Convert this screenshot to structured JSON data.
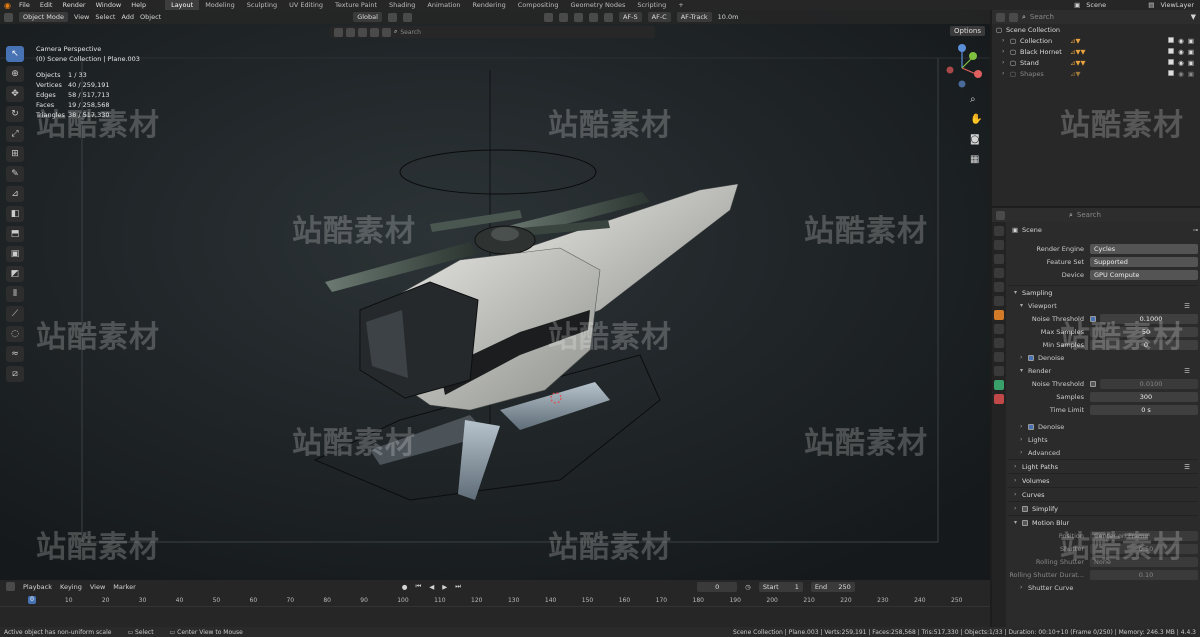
{
  "menus": [
    "File",
    "Edit",
    "Render",
    "Window",
    "Help"
  ],
  "workspaces": [
    "Layout",
    "Modeling",
    "Sculpting",
    "UV Editing",
    "Texture Paint",
    "Shading",
    "Animation",
    "Rendering",
    "Compositing",
    "Geometry Nodes",
    "Scripting"
  ],
  "scene_name": "Scene",
  "view_layer": "ViewLayer",
  "viewport": {
    "mode": "Object Mode",
    "menus": [
      "View",
      "Select",
      "Add",
      "Object"
    ],
    "transform": "Global",
    "af_labels": [
      "AF-S",
      "AF-C",
      "AF-Track"
    ],
    "distance": "10.0m",
    "options_label": "Options",
    "search_placeholder": "Search"
  },
  "stats": {
    "camera": "Camera Perspective",
    "path": "(0) Scene Collection | Plane.003",
    "rows": [
      {
        "k": "Objects",
        "v": "1 / 33"
      },
      {
        "k": "Vertices",
        "v": "40 / 259,191"
      },
      {
        "k": "Edges",
        "v": "58 / 517,713"
      },
      {
        "k": "Faces",
        "v": "19 / 258,568"
      },
      {
        "k": "Triangles",
        "v": "38 / 517,330"
      }
    ]
  },
  "watermark": "站酷素材",
  "outliner": {
    "search_placeholder": "Search",
    "root": "Scene Collection",
    "items": [
      "Collection",
      "Black Hornet",
      "Stand",
      "Shapes"
    ]
  },
  "properties": {
    "search_placeholder": "Search",
    "context": "Scene",
    "render_engine_label": "Render Engine",
    "render_engine": "Cycles",
    "feature_set_label": "Feature Set",
    "feature_set": "Supported",
    "device_label": "Device",
    "device": "GPU Compute",
    "sampling": "Sampling",
    "viewport": "Viewport",
    "noise_threshold_label": "Noise Threshold",
    "vp_noise": "0.1000",
    "max_samples_label": "Max Samples",
    "vp_max": "50",
    "min_samples_label": "Min Samples",
    "vp_min": "0",
    "denoise": "Denoise",
    "render": "Render",
    "r_noise": "0.0100",
    "samples_label": "Samples",
    "r_samples": "300",
    "time_limit_label": "Time Limit",
    "r_time": "0 s",
    "lights": "Lights",
    "advanced": "Advanced",
    "light_paths": "Light Paths",
    "volumes": "Volumes",
    "curves": "Curves",
    "simplify": "Simplify",
    "motion_blur": "Motion Blur",
    "position_label": "Position",
    "position": "Center on Frame",
    "shutter_label": "Shutter",
    "shutter": "0.50",
    "rolling_shutter_label": "Rolling Shutter",
    "rolling_shutter": "None",
    "rolling_duration_label": "Rolling Shutter Durat...",
    "rolling_duration": "0.10",
    "shutter_curve": "Shutter Curve"
  },
  "timeline": {
    "menus": [
      "Playback",
      "Keying",
      "View",
      "Marker"
    ],
    "current": "0",
    "start_label": "Start",
    "start": "1",
    "end_label": "End",
    "end": "250",
    "ticks": [
      "0",
      "10",
      "20",
      "30",
      "40",
      "50",
      "60",
      "70",
      "80",
      "90",
      "100",
      "110",
      "120",
      "130",
      "140",
      "150",
      "160",
      "170",
      "180",
      "190",
      "200",
      "210",
      "220",
      "230",
      "240",
      "250"
    ]
  },
  "status": {
    "hint": "Active object has non-uniform scale",
    "select": "Select",
    "center": "Center View to Mouse",
    "info": "Scene Collection | Plane.003 | Verts:259,191 | Faces:258,568 | Tris:517,330 | Objects:1/33 | Duration: 00:10+10 (Frame 0/250) | Memory: 246.3 MB | 4.4.3"
  }
}
